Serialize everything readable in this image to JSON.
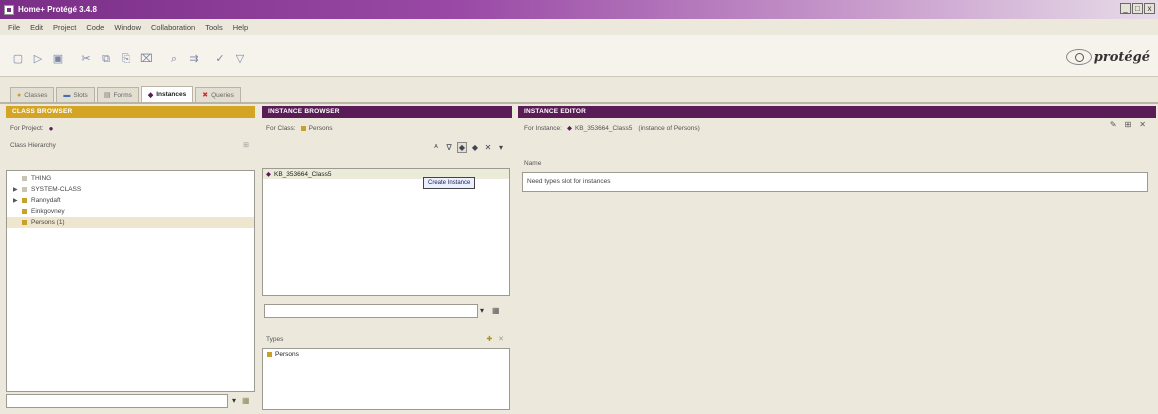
{
  "window": {
    "title": "Home+ Protégé 3.4.8",
    "minimize": "_",
    "maximize": "□",
    "close": "x"
  },
  "menu": [
    "File",
    "Edit",
    "Project",
    "Code",
    "Window",
    "Collaboration",
    "Tools",
    "Help"
  ],
  "toolbar": {
    "icons": [
      "new-icon",
      "open-icon",
      "save-icon",
      "cut-icon",
      "copy-icon",
      "paste-icon",
      "delete-icon",
      "find-icon",
      "merge-icon",
      "check-icon",
      "filter-icon"
    ],
    "logo_text": "protégé"
  },
  "tabs": [
    {
      "label": "Classes",
      "icon": "class-icon"
    },
    {
      "label": "Slots",
      "icon": "slot-icon"
    },
    {
      "label": "Forms",
      "icon": "form-icon"
    },
    {
      "label": "Instances",
      "icon": "instance-icon",
      "active": true
    },
    {
      "label": "Queries",
      "icon": "query-icon"
    }
  ],
  "class_browser": {
    "header": "CLASS BROWSER",
    "for_project_label": "For Project:",
    "hierarchy_label": "Class Hierarchy",
    "tree": [
      {
        "label": "THING",
        "indent": 0,
        "expander": "",
        "color": "#c9c4b4"
      },
      {
        "label": "SYSTEM-CLASS",
        "indent": 0,
        "expander": "▶",
        "color": "#c9c4b4"
      },
      {
        "label": "Rannydaft",
        "indent": 0,
        "expander": "▶",
        "color": "#c8a12a"
      },
      {
        "label": "Einkgovney",
        "indent": 0,
        "expander": "",
        "color": "#c8a12a"
      },
      {
        "label": "Persons (1)",
        "indent": 0,
        "expander": "",
        "color": "#c8a12a",
        "selected": true
      }
    ]
  },
  "instance_browser": {
    "header": "INSTANCE BROWSER",
    "for_class_label": "For Class:",
    "for_class_value": "Persons",
    "instances": [
      "KB_353664_Class5"
    ],
    "tooltip": "Create Instance",
    "types_label": "Types",
    "types": [
      "Persons"
    ]
  },
  "instance_editor": {
    "header": "INSTANCE EDITOR",
    "for_instance_label": "For Instance:",
    "for_instance_value": "KB_353664_Class5",
    "instance_of": "(instance of Persons)",
    "name_label": "Name",
    "name_value": "Need types slot for instances"
  }
}
